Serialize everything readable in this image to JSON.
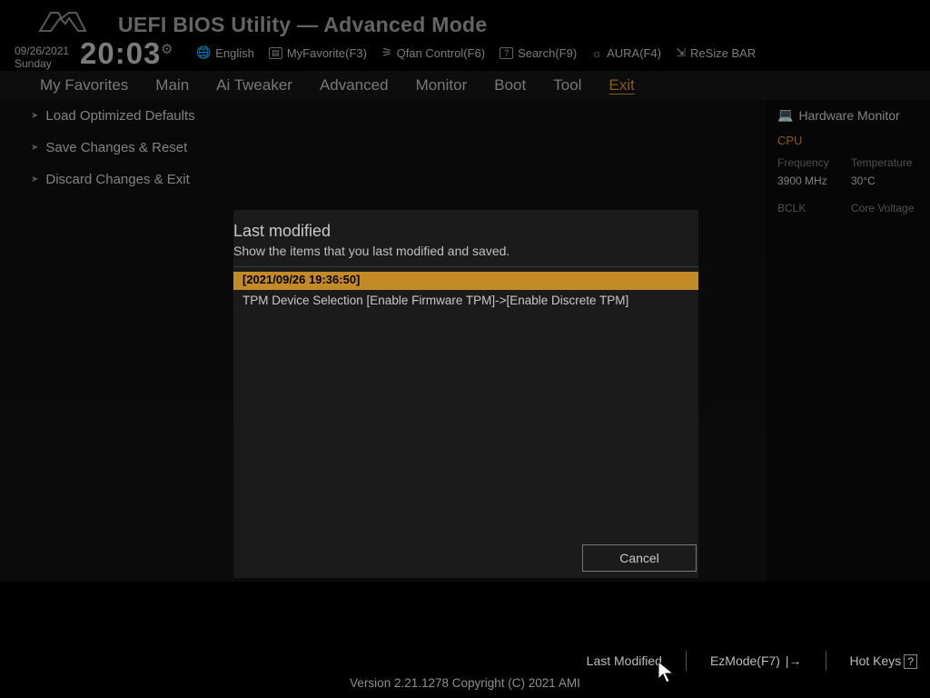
{
  "header": {
    "app_title": "UEFI BIOS Utility — Advanced Mode",
    "date": "09/26/2021",
    "day": "Sunday",
    "clock": "20:03",
    "tools": {
      "language": "English",
      "myfavorite": "MyFavorite(F3)",
      "qfan": "Qfan Control(F6)",
      "search": "Search(F9)",
      "aura": "AURA(F4)",
      "resize": "ReSize BAR"
    }
  },
  "tabs": [
    "My Favorites",
    "Main",
    "Ai Tweaker",
    "Advanced",
    "Monitor",
    "Boot",
    "Tool",
    "Exit"
  ],
  "active_tab": "Exit",
  "exit_menu": [
    "Load Optimized Defaults",
    "Save Changes & Reset",
    "Discard Changes & Exit"
  ],
  "hw": {
    "panel_title": "Hardware Monitor",
    "section_cpu": "CPU",
    "labels": {
      "freq": "Frequency",
      "temp": "Temperature",
      "bclk": "BCLK",
      "cv": "Core Voltage"
    },
    "values": {
      "freq": "3900 MHz",
      "temp": "30°C"
    }
  },
  "modal": {
    "title": "Last modified",
    "subtitle": "Show the items that you last modified and saved.",
    "highlight": "[2021/09/26 19:36:50]",
    "line": "TPM Device Selection [Enable Firmware TPM]->[Enable Discrete TPM]",
    "cancel": "Cancel"
  },
  "footer": {
    "last_modified": "Last Modified",
    "ezmode": "EzMode(F7)",
    "hotkeys": "Hot Keys",
    "hotkeys_box": "?",
    "copyright": "Version 2.21.1278 Copyright (C) 2021 AMI"
  }
}
